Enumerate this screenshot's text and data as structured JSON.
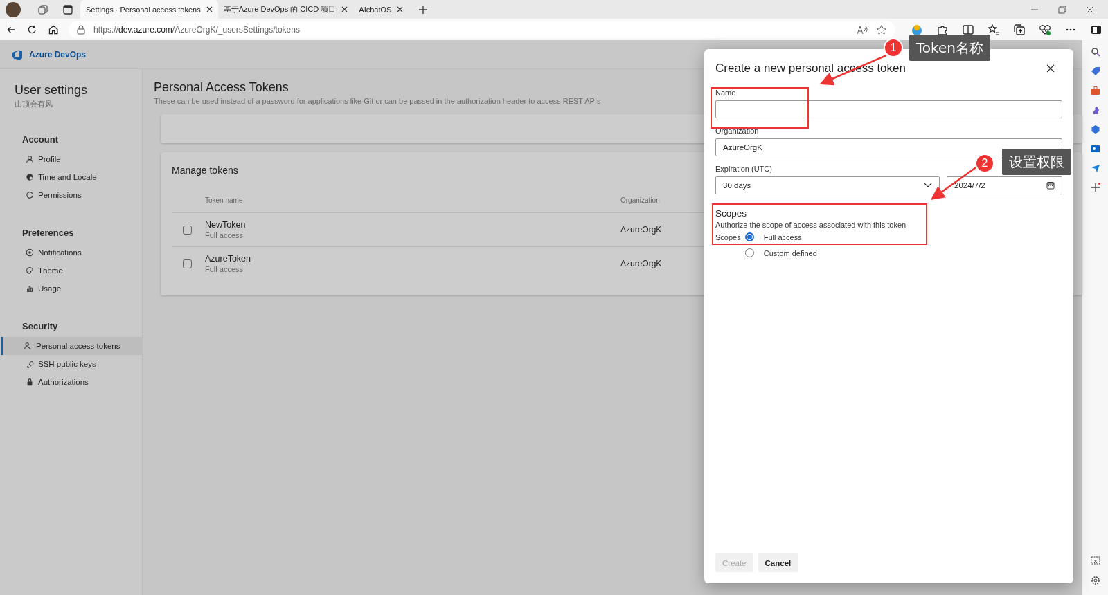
{
  "browser": {
    "tabs": [
      {
        "title": "Settings · Personal access tokens",
        "selected": true
      },
      {
        "title": "基于Azure DevOps 的 CICD 项目",
        "selected": false
      },
      {
        "title": "AIchatOS",
        "selected": false
      }
    ],
    "url_scheme": "https://",
    "url_host": "dev.azure.com",
    "url_path": "/AzureOrgK/_usersSettings/tokens"
  },
  "app": {
    "name": "Azure DevOps"
  },
  "sidebar": {
    "title": "User settings",
    "subtitle": "山顶会有风",
    "sections": [
      {
        "heading": "Account",
        "items": [
          {
            "label": "Profile",
            "selected": false
          },
          {
            "label": "Time and Locale",
            "selected": false
          },
          {
            "label": "Permissions",
            "selected": false
          }
        ]
      },
      {
        "heading": "Preferences",
        "items": [
          {
            "label": "Notifications",
            "selected": false
          },
          {
            "label": "Theme",
            "selected": false
          },
          {
            "label": "Usage",
            "selected": false
          }
        ]
      },
      {
        "heading": "Security",
        "items": [
          {
            "label": "Personal access tokens",
            "selected": true
          },
          {
            "label": "SSH public keys",
            "selected": false
          },
          {
            "label": "Authorizations",
            "selected": false
          }
        ]
      }
    ]
  },
  "main": {
    "title": "Personal Access Tokens",
    "description": "These can be used instead of a password for applications like Git or can be passed in the authorization header to access REST APIs",
    "card_title": "Manage tokens",
    "columns": [
      "Token name",
      "Organization"
    ],
    "rows": [
      {
        "name": "NewToken",
        "scope": "Full access",
        "organization": "AzureOrgK",
        "checked": false
      },
      {
        "name": "AzureToken",
        "scope": "Full access",
        "organization": "AzureOrgK",
        "checked": false
      }
    ]
  },
  "dialog": {
    "title": "Create a new personal access token",
    "name_label": "Name",
    "organization_label": "Organization",
    "organization": "AzureOrgK",
    "expiration_label": "Expiration (UTC)",
    "expiration": "30 days",
    "date": "2024/7/2",
    "scopes_title": "Scopes",
    "scopes_description": "Authorize the scope of access associated with this token",
    "scopes_label": "Scopes",
    "scope_options": [
      {
        "label": "Full access",
        "selected": true
      },
      {
        "label": "Custom defined",
        "selected": false
      }
    ],
    "buttons": [
      {
        "label": "Create",
        "disabled": true
      },
      {
        "label": "Cancel",
        "disabled": false
      }
    ]
  },
  "annotations": [
    {
      "number": "1",
      "text": "Token名称"
    },
    {
      "number": "2",
      "text": "设置权限"
    }
  ]
}
